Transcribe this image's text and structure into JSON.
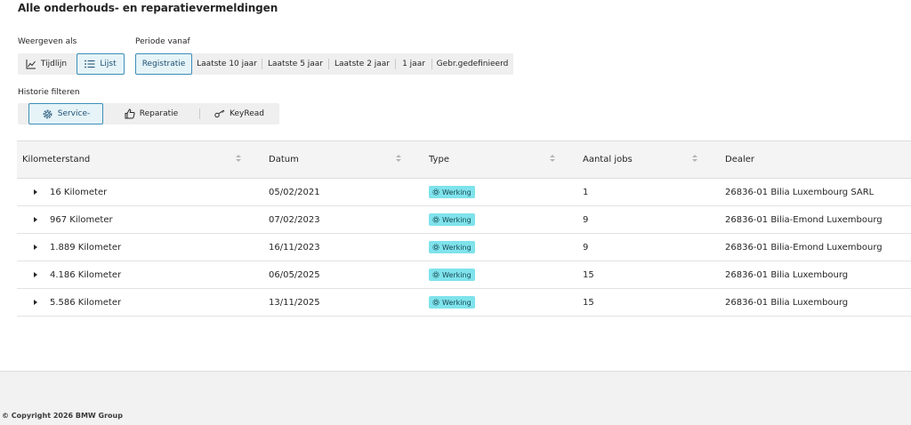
{
  "page": {
    "title": "Alle onderhouds- en reparatievermeldingen"
  },
  "view": {
    "label": "Weergeven als",
    "options": [
      {
        "label": "Tijdlijn",
        "icon": "line-chart-icon",
        "active": false
      },
      {
        "label": "Lijst",
        "icon": "list-icon",
        "active": true
      }
    ]
  },
  "period": {
    "label": "Periode vanaf",
    "options": [
      {
        "label": "Registratie",
        "active": true
      },
      {
        "label": "Laatste 10 jaar",
        "active": false
      },
      {
        "label": "Laatste 5 jaar",
        "active": false
      },
      {
        "label": "Laatste 2 jaar",
        "active": false
      },
      {
        "label": "1 jaar",
        "active": false
      },
      {
        "label": "Gebr.gedefinieerd",
        "active": false
      }
    ]
  },
  "filter": {
    "label": "Historie filteren",
    "options": [
      {
        "label": "Service-",
        "icon": "gear-icon",
        "active": true
      },
      {
        "label": "Reparatie",
        "icon": "thumbs-up-icon",
        "active": false
      },
      {
        "label": "KeyRead",
        "icon": "key-icon",
        "active": false
      }
    ]
  },
  "table": {
    "columns": [
      "Kilometerstand",
      "Datum",
      "Type",
      "Aantal jobs",
      "Dealer"
    ],
    "rows": [
      {
        "km": "16 Kilometer",
        "date": "05/02/2021",
        "type": "Werking",
        "jobs": "1",
        "dealer": "26836-01 Bilia Luxembourg SARL"
      },
      {
        "km": "967 Kilometer",
        "date": "07/02/2023",
        "type": "Werking",
        "jobs": "9",
        "dealer": "26836-01 Bilia-Emond Luxembourg"
      },
      {
        "km": "1.889 Kilometer",
        "date": "16/11/2023",
        "type": "Werking",
        "jobs": "9",
        "dealer": "26836-01 Bilia-Emond Luxembourg"
      },
      {
        "km": "4.186 Kilometer",
        "date": "06/05/2025",
        "type": "Werking",
        "jobs": "15",
        "dealer": "26836-01 Bilia Luxembourg"
      },
      {
        "km": "5.586 Kilometer",
        "date": "13/11/2025",
        "type": "Werking",
        "jobs": "15",
        "dealer": "26836-01 Bilia Luxembourg"
      }
    ]
  },
  "footer": {
    "copyright": "© Copyright 2026 BMW Group"
  },
  "colors": {
    "accent": "#3d8eb9",
    "badge": "#7fe3ec",
    "background": "#f2f2f2"
  }
}
